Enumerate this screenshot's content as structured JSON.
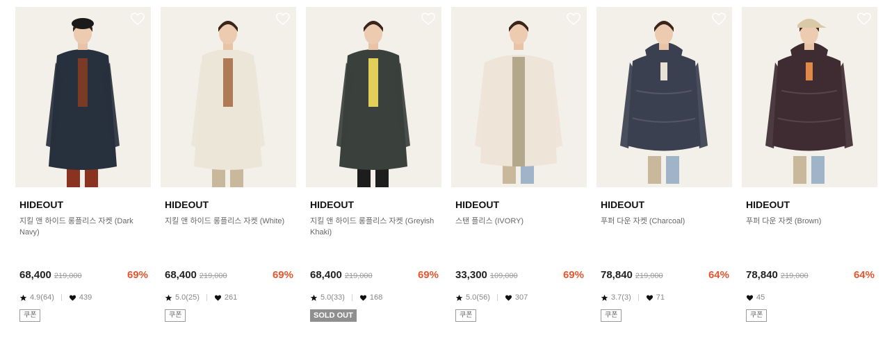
{
  "products": [
    {
      "brand": "HIDEOUT",
      "name": "지킬 앤 하이드 롱플리스 자켓 (Dark Navy)",
      "price": "68,400",
      "original_price": "219,000",
      "discount": "69%",
      "rating": "4.9(64)",
      "likes": "439",
      "tag": "쿠폰",
      "tag_type": "coupon",
      "bg": "#f3efe9",
      "garment": "#27303d",
      "accent": "#7a3a25"
    },
    {
      "brand": "HIDEOUT",
      "name": "지킬 앤 하이드 롱플리스 자켓 (White)",
      "price": "68,400",
      "original_price": "219,000",
      "discount": "69%",
      "rating": "5.0(25)",
      "likes": "261",
      "tag": "쿠폰",
      "tag_type": "coupon",
      "bg": "#f3efe9",
      "garment": "#ece6d9",
      "accent": "#b07a55"
    },
    {
      "brand": "HIDEOUT",
      "name": "지킬 앤 하이드 롱플리스 자켓 (Greyish Khaki)",
      "price": "68,400",
      "original_price": "219,000",
      "discount": "69%",
      "rating": "5.0(33)",
      "likes": "168",
      "tag": "SOLD OUT",
      "tag_type": "soldout",
      "bg": "#f3efe9",
      "garment": "#3a403c",
      "accent": "#e2cf5a"
    },
    {
      "brand": "HIDEOUT",
      "name": "스탠 플리스 (IVORY)",
      "price": "33,300",
      "original_price": "109,000",
      "discount": "69%",
      "rating": "5.0(56)",
      "likes": "307",
      "tag": "쿠폰",
      "tag_type": "coupon",
      "bg": "#f3efe9",
      "garment": "#efe4d8",
      "accent": "#b4a88c"
    },
    {
      "brand": "HIDEOUT",
      "name": "푸퍼 다운 자켓 (Charcoal)",
      "price": "78,840",
      "original_price": "219,000",
      "discount": "64%",
      "rating": "3.7(3)",
      "likes": "71",
      "tag": "쿠폰",
      "tag_type": "coupon",
      "bg": "#f3efe9",
      "garment": "#3b4050",
      "accent": "#e8e2d6"
    },
    {
      "brand": "HIDEOUT",
      "name": "푸퍼 다운 자켓 (Brown)",
      "price": "78,840",
      "original_price": "219,000",
      "discount": "64%",
      "rating": "",
      "likes": "45",
      "tag": "쿠폰",
      "tag_type": "coupon",
      "bg": "#f3efe9",
      "garment": "#3e2c32",
      "accent": "#e28a45"
    }
  ],
  "colors": {
    "discount": "#e8552e",
    "price": "#222222",
    "strike": "#9a9a9a",
    "soldout_bg": "#8f8f8f"
  },
  "icons": {
    "wishlist": "heart-outline-icon",
    "rating": "star-icon",
    "likes": "heart-filled-icon"
  }
}
